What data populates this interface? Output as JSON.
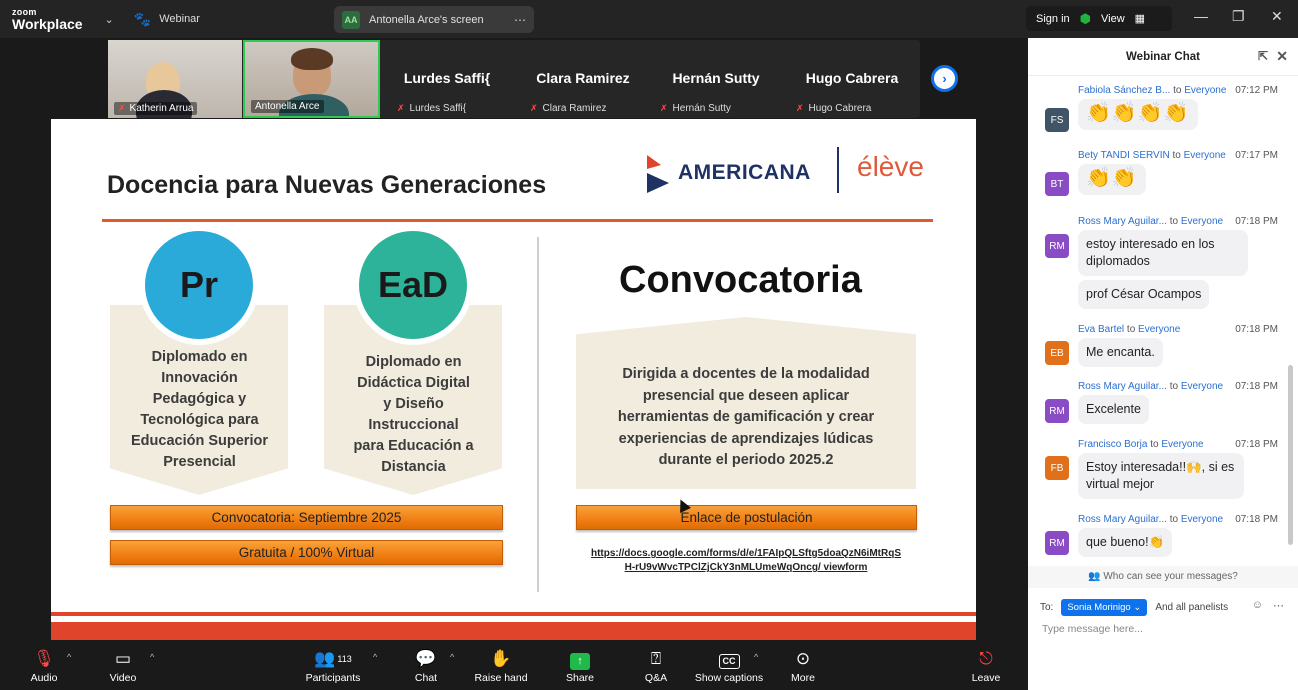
{
  "topbar": {
    "logo_line1": "zoom",
    "logo_line2": "Workplace",
    "webinar_label": "Webinar",
    "screen_badge": "AA",
    "screen_label": "Antonella Arce's screen",
    "sign_in": "Sign in",
    "view": "View"
  },
  "gallery": {
    "tiles": [
      {
        "name": "Katherin Arrua"
      },
      {
        "name": "Antonella Arce"
      },
      {
        "name": "Lurdes Saffi{",
        "big": "Lurdes Saffi{"
      },
      {
        "name": "Clara Ramirez",
        "big": "Clara Ramirez"
      },
      {
        "name": "Hernán Sutty",
        "big": "Hernán Sutty"
      },
      {
        "name": "Hugo Cabrera",
        "big": "Hugo Cabrera"
      }
    ]
  },
  "slide": {
    "title": "Docencia para Nuevas Generaciones",
    "brand1": "AMERICANA",
    "brand2": "élève",
    "card1": {
      "badge": "Pr",
      "lines": [
        "Diplomado en",
        "Innovación",
        "Pedagógica y",
        "Tecnológica para",
        "Educación Superior",
        "Presencial"
      ],
      "color": "#29aad8"
    },
    "card2": {
      "badge": "EaD",
      "lines": [
        "Diplomado en",
        "Didáctica Digital",
        "y Diseño",
        "Instruccional",
        "para Educación a",
        "Distancia"
      ],
      "color": "#2db39a"
    },
    "btn_convocatoria": "Convocatoria: Septiembre 2025",
    "btn_gratuita": "Gratuita / 100% Virtual",
    "conv_title": "Convocatoria",
    "conv_lines": [
      "Dirigida a docentes de la modalidad",
      "presencial que deseen aplicar",
      "herramientas de gamificación y crear",
      "experiencias de aprendizajes lúdicas",
      "durante el periodo 2025.2"
    ],
    "btn_enlace": "Enlace de postulación",
    "link_line1": "https://docs.google.com/forms/d/e/1FAIpQLSftg5doaQzN6iMtRqS",
    "link_line2": "H-rU9vWvcTPClZjCkY3nMLUmeWqOncg/ viewform"
  },
  "toolbar": {
    "audio": "Audio",
    "video": "Video",
    "participants": "Participants",
    "participants_count": "113",
    "chat": "Chat",
    "raise_hand": "Raise hand",
    "share": "Share",
    "qa": "Q&A",
    "captions": "Show captions",
    "captions_icon": "CC",
    "more": "More",
    "leave": "Leave"
  },
  "chat": {
    "title": "Webinar Chat",
    "to_word": "to",
    "everyone": "Everyone",
    "messages": [
      {
        "initials": "FS",
        "color": "#3f5466",
        "sender": "Fabiola Sánchez B...",
        "time": "07:12 PM",
        "text": "👏👏👏👏"
      },
      {
        "initials": "BT",
        "color": "#8a4cc5",
        "sender": "Bety TANDI SERVIN",
        "time": "07:17 PM",
        "text": "👏👏"
      },
      {
        "initials": "RM",
        "color": "#8a4cc5",
        "sender": "Ross Mary Aguilar...",
        "time": "07:18 PM",
        "text": "estoy interesado en los diplomados",
        "text2": "prof César Ocampos"
      },
      {
        "initials": "EB",
        "color": "#e0701a",
        "sender": "Eva Bartel",
        "time": "07:18 PM",
        "text": "Me encanta."
      },
      {
        "initials": "RM",
        "color": "#8a4cc5",
        "sender": "Ross Mary Aguilar...",
        "time": "07:18 PM",
        "text": "Excelente"
      },
      {
        "initials": "FB",
        "color": "#e0701a",
        "sender": "Francisco Borja",
        "time": "07:18 PM",
        "text": "Estoy interesada!!🙌, si es virtual mejor"
      },
      {
        "initials": "RM",
        "color": "#8a4cc5",
        "sender": "Ross Mary Aguilar...",
        "time": "07:18 PM",
        "text": "que bueno!👏"
      }
    ],
    "who_can_see": "Who can see your messages?",
    "to_label": "To:",
    "to_recipient": "Sonia Morinigo",
    "and_panelists": "And all panelists",
    "placeholder": "Type message here..."
  }
}
